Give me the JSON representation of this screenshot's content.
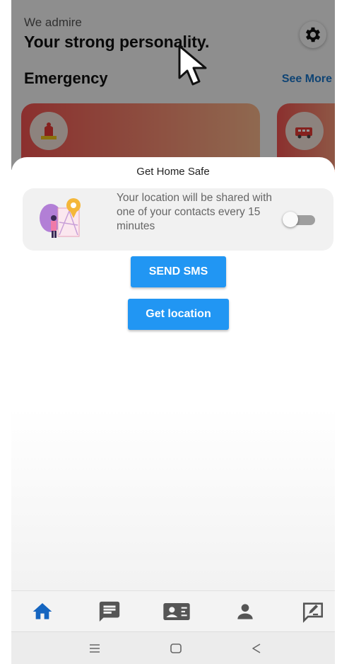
{
  "background": {
    "greeting_small": "We admire",
    "greeting_big": "Your strong personality.",
    "section_title": "Emergency",
    "see_more": "See More"
  },
  "sheet": {
    "title": "Get Home Safe",
    "card_text": "Your location will be shared with one of your contacts every 15 minutes",
    "toggle_on": false,
    "send_sms_label": "SEND SMS",
    "get_location_label": "Get location"
  },
  "bottom_nav": {
    "items": [
      "home-icon",
      "chat-icon",
      "contacts-icon",
      "profile-icon",
      "feedback-icon"
    ],
    "active": "home-icon"
  },
  "system_nav": [
    "menu-icon",
    "home-square-icon",
    "back-triangle-icon"
  ],
  "colors": {
    "primary": "#2196f3",
    "accent_link": "#1b75c9",
    "emergency_gradient_start": "#ef5350",
    "emergency_gradient_end": "#f7b58a",
    "active_nav": "#1565c0",
    "inactive_nav": "#555555"
  }
}
